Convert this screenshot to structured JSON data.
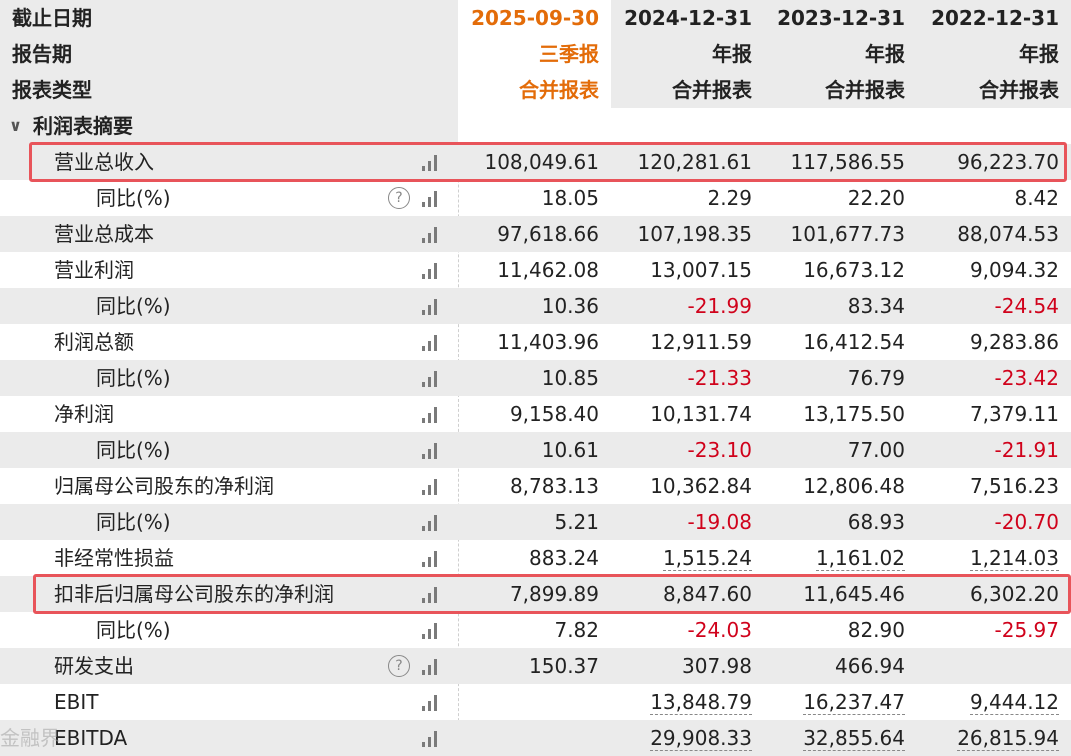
{
  "header": {
    "rows": [
      {
        "label": "截止日期",
        "values": [
          "2025-09-30",
          "2024-12-31",
          "2023-12-31",
          "2022-12-31"
        ]
      },
      {
        "label": "报告期",
        "values": [
          "三季报",
          "年报",
          "年报",
          "年报"
        ]
      },
      {
        "label": "报表类型",
        "values": [
          "合并报表",
          "合并报表",
          "合并报表",
          "合并报表"
        ]
      }
    ]
  },
  "section": {
    "title": "利润表摘要",
    "chevron": "chevron-down-icon"
  },
  "rows": [
    {
      "label": "营业总收入",
      "indent": 1,
      "help": false,
      "values": [
        "108,049.61",
        "120,281.61",
        "117,586.55",
        "96,223.70"
      ]
    },
    {
      "label": "同比(%)",
      "indent": 2,
      "help": true,
      "values": [
        "18.05",
        "2.29",
        "22.20",
        "8.42"
      ]
    },
    {
      "label": "营业总成本",
      "indent": 1,
      "help": false,
      "values": [
        "97,618.66",
        "107,198.35",
        "101,677.73",
        "88,074.53"
      ]
    },
    {
      "label": "营业利润",
      "indent": 1,
      "help": false,
      "values": [
        "11,462.08",
        "13,007.15",
        "16,673.12",
        "9,094.32"
      ]
    },
    {
      "label": "同比(%)",
      "indent": 2,
      "help": false,
      "values": [
        "10.36",
        "-21.99",
        "83.34",
        "-24.54"
      ]
    },
    {
      "label": "利润总额",
      "indent": 1,
      "help": false,
      "values": [
        "11,403.96",
        "12,911.59",
        "16,412.54",
        "9,283.86"
      ]
    },
    {
      "label": "同比(%)",
      "indent": 2,
      "help": false,
      "values": [
        "10.85",
        "-21.33",
        "76.79",
        "-23.42"
      ]
    },
    {
      "label": "净利润",
      "indent": 1,
      "help": false,
      "values": [
        "9,158.40",
        "10,131.74",
        "13,175.50",
        "7,379.11"
      ]
    },
    {
      "label": "同比(%)",
      "indent": 2,
      "help": false,
      "values": [
        "10.61",
        "-23.10",
        "77.00",
        "-21.91"
      ]
    },
    {
      "label": "归属母公司股东的净利润",
      "indent": 1,
      "help": false,
      "values": [
        "8,783.13",
        "10,362.84",
        "12,806.48",
        "7,516.23"
      ]
    },
    {
      "label": "同比(%)",
      "indent": 2,
      "help": false,
      "values": [
        "5.21",
        "-19.08",
        "68.93",
        "-20.70"
      ]
    },
    {
      "label": "非经常性损益",
      "indent": 1,
      "help": false,
      "values": [
        "883.24",
        "1,515.24",
        "1,161.02",
        "1,214.03"
      ]
    },
    {
      "label": "扣非后归属母公司股东的净利润",
      "indent": 1,
      "help": false,
      "values": [
        "7,899.89",
        "8,847.60",
        "11,645.46",
        "6,302.20"
      ]
    },
    {
      "label": "同比(%)",
      "indent": 2,
      "help": false,
      "values": [
        "7.82",
        "-24.03",
        "82.90",
        "-25.97"
      ]
    },
    {
      "label": "研发支出",
      "indent": 1,
      "help": true,
      "values": [
        "150.37",
        "307.98",
        "466.94",
        ""
      ]
    },
    {
      "label": "EBIT",
      "indent": 1,
      "help": false,
      "values": [
        "",
        "13,848.79",
        "16,237.47",
        "9,444.12"
      ]
    },
    {
      "label": "EBITDA",
      "indent": 1,
      "help": false,
      "values": [
        "",
        "29,908.33",
        "32,855.64",
        "26,815.94"
      ]
    }
  ],
  "watermark": "金融界",
  "colors": {
    "current_period": "#e36c09",
    "negative": "#d0021b",
    "highlight_box": "#e8545a"
  },
  "icons": {
    "chart": "bar-chart-icon",
    "help": "question-circle-icon"
  }
}
